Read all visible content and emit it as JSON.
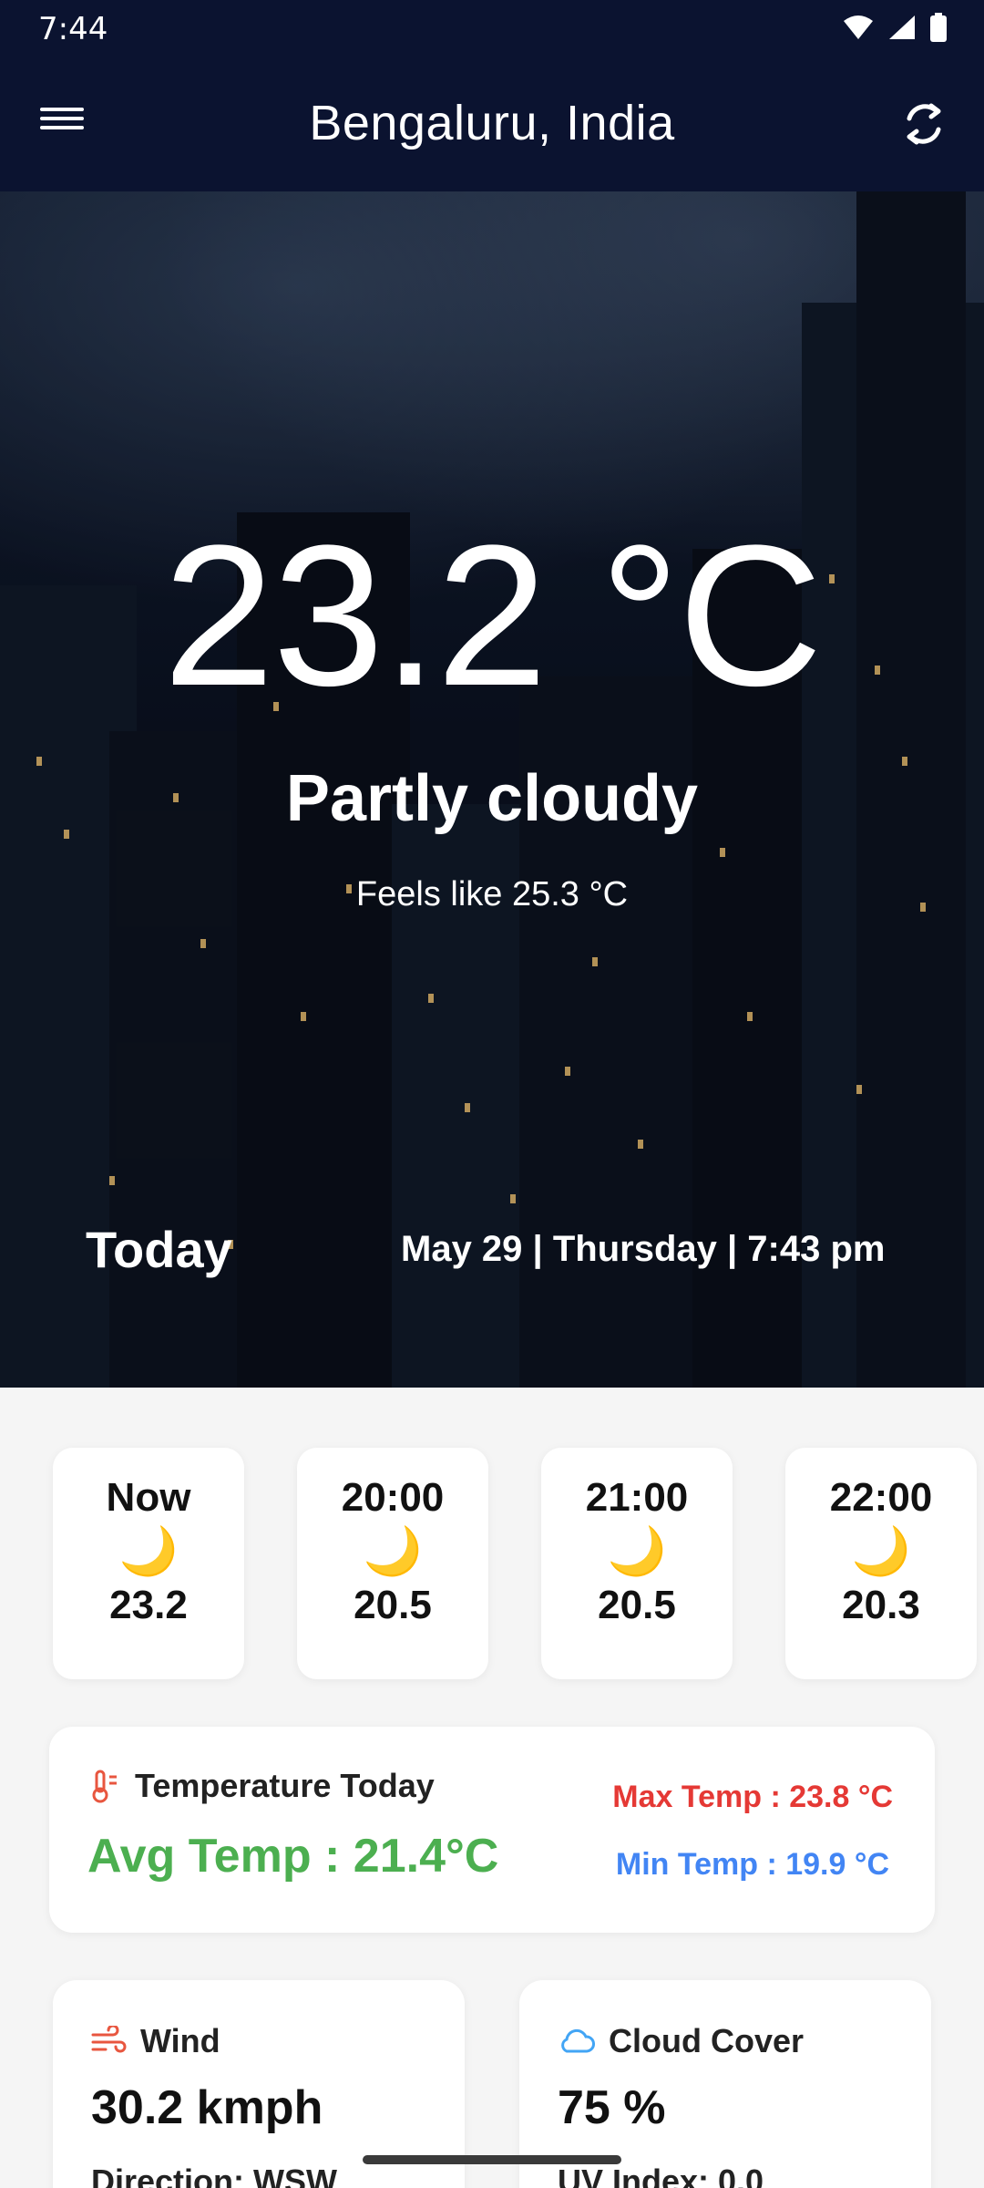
{
  "status_bar": {
    "time": "7:44"
  },
  "app_bar": {
    "title": "Bengaluru, India",
    "menu_icon": "menu-icon",
    "refresh_icon": "refresh-icon"
  },
  "current": {
    "temperature": "23.2 °C",
    "condition": "Partly cloudy",
    "feels_like": "Feels like 25.3 °C",
    "today_label": "Today",
    "date_line": "May 29 | Thursday | 7:43 pm"
  },
  "hourly": [
    {
      "label": "Now",
      "icon": "🌙",
      "temp": "23.2"
    },
    {
      "label": "20:00",
      "icon": "🌙",
      "temp": "20.5"
    },
    {
      "label": "21:00",
      "icon": "🌙",
      "temp": "20.5"
    },
    {
      "label": "22:00",
      "icon": "🌙",
      "temp": "20.3"
    }
  ],
  "temperature_today": {
    "title": "Temperature Today",
    "avg": "Avg Temp : 21.4°C",
    "max": "Max Temp : 23.8 °C",
    "min": "Min Temp : 19.9 °C"
  },
  "wind": {
    "title": "Wind",
    "value": "30.2 kmph",
    "sub": "Direction: WSW"
  },
  "cloud": {
    "title": "Cloud Cover",
    "value": "75 %",
    "sub": "UV Index: 0.0"
  },
  "colors": {
    "appbar": "#0b1330",
    "avg": "#4caf50",
    "max": "#e53935",
    "min": "#4285f4"
  }
}
